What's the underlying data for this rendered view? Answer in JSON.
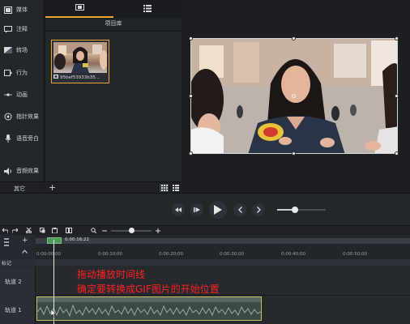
{
  "sidebar": {
    "items": [
      {
        "label": "媒体",
        "icon": "media-icon"
      },
      {
        "label": "注释",
        "icon": "annotation-icon"
      },
      {
        "label": "转场",
        "icon": "transition-icon"
      },
      {
        "label": "行为",
        "icon": "behavior-icon"
      },
      {
        "label": "动画",
        "icon": "animation-icon"
      },
      {
        "label": "指针效果",
        "icon": "cursor-effect-icon"
      },
      {
        "label": "语音旁白",
        "icon": "voice-narration-icon"
      },
      {
        "label": "音频效果",
        "icon": "audio-effect-icon"
      }
    ],
    "more_label": "其它"
  },
  "bin": {
    "title": "项目库",
    "add_label": "+",
    "clip_name": "95bef53933b35..."
  },
  "timeline": {
    "playhead_time": "0:00:16;22",
    "ruler_labels": [
      "0:00:00;00",
      "0:00:10;00",
      "0:00:20;00",
      "0:00:30;00",
      "0:00:40;00",
      "0:00:50;00"
    ],
    "marker_label": "标记",
    "tracks": [
      {
        "label": "轨道 2"
      },
      {
        "label": "轨道 1"
      }
    ]
  },
  "overlay": {
    "line1": "拖动播放时间线",
    "line2": "确定要转换成GIF图片的开始位置"
  },
  "colors": {
    "accent": "#e8a733",
    "overlay_text": "#ff2020"
  }
}
